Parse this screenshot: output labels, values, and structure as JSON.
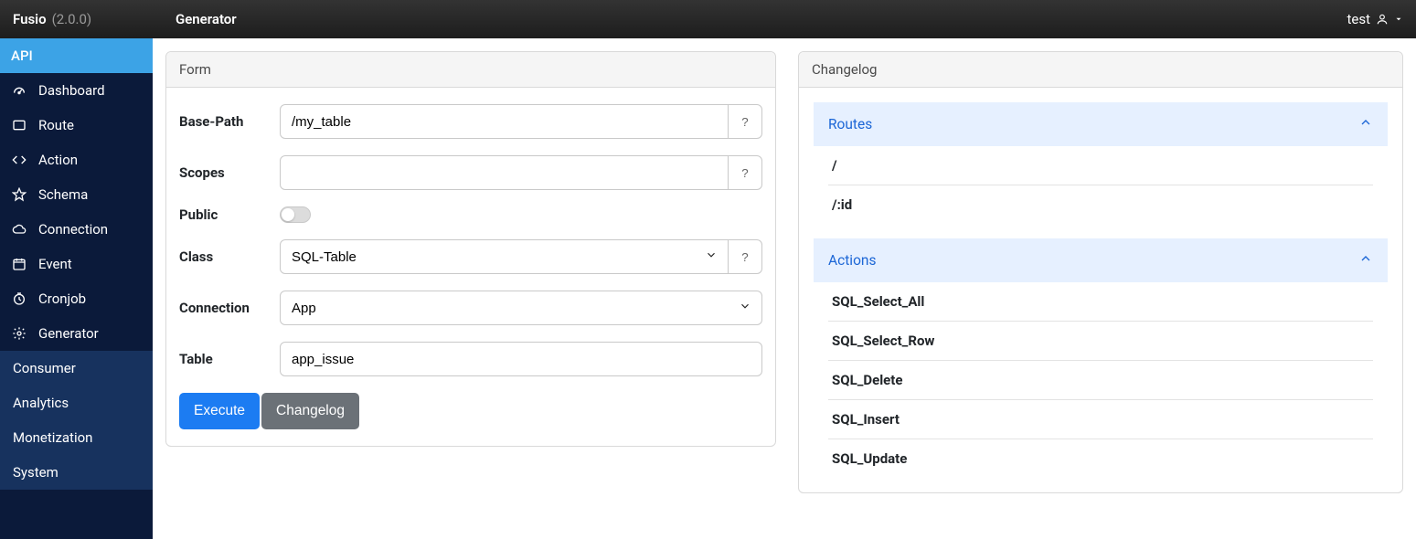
{
  "topbar": {
    "brand": "Fusio",
    "version": "(2.0.0)",
    "title": "Generator",
    "user": "test"
  },
  "sidebar": {
    "sections": [
      {
        "label": "API",
        "active": true,
        "items": [
          {
            "icon": "gauge-icon",
            "label": "Dashboard"
          },
          {
            "icon": "route-icon",
            "label": "Route"
          },
          {
            "icon": "code-icon",
            "label": "Action"
          },
          {
            "icon": "star-icon",
            "label": "Schema"
          },
          {
            "icon": "cloud-icon",
            "label": "Connection"
          },
          {
            "icon": "calendar-icon",
            "label": "Event"
          },
          {
            "icon": "clock-icon",
            "label": "Cronjob"
          },
          {
            "icon": "cog-icon",
            "label": "Generator"
          }
        ]
      },
      {
        "label": "Consumer",
        "active": false
      },
      {
        "label": "Analytics",
        "active": false
      },
      {
        "label": "Monetization",
        "active": false
      },
      {
        "label": "System",
        "active": false
      }
    ]
  },
  "form": {
    "title": "Form",
    "fields": {
      "basepath_label": "Base-Path",
      "basepath_value": "/my_table",
      "scopes_label": "Scopes",
      "scopes_value": "",
      "public_label": "Public",
      "class_label": "Class",
      "class_value": "SQL-Table",
      "connection_label": "Connection",
      "connection_value": "App",
      "table_label": "Table",
      "table_value": "app_issue",
      "help": "?"
    },
    "buttons": {
      "execute": "Execute",
      "changelog": "Changelog"
    }
  },
  "changelog": {
    "title": "Changelog",
    "routes_label": "Routes",
    "routes": [
      "/",
      "/:id"
    ],
    "actions_label": "Actions",
    "actions": [
      "SQL_Select_All",
      "SQL_Select_Row",
      "SQL_Delete",
      "SQL_Insert",
      "SQL_Update"
    ]
  }
}
